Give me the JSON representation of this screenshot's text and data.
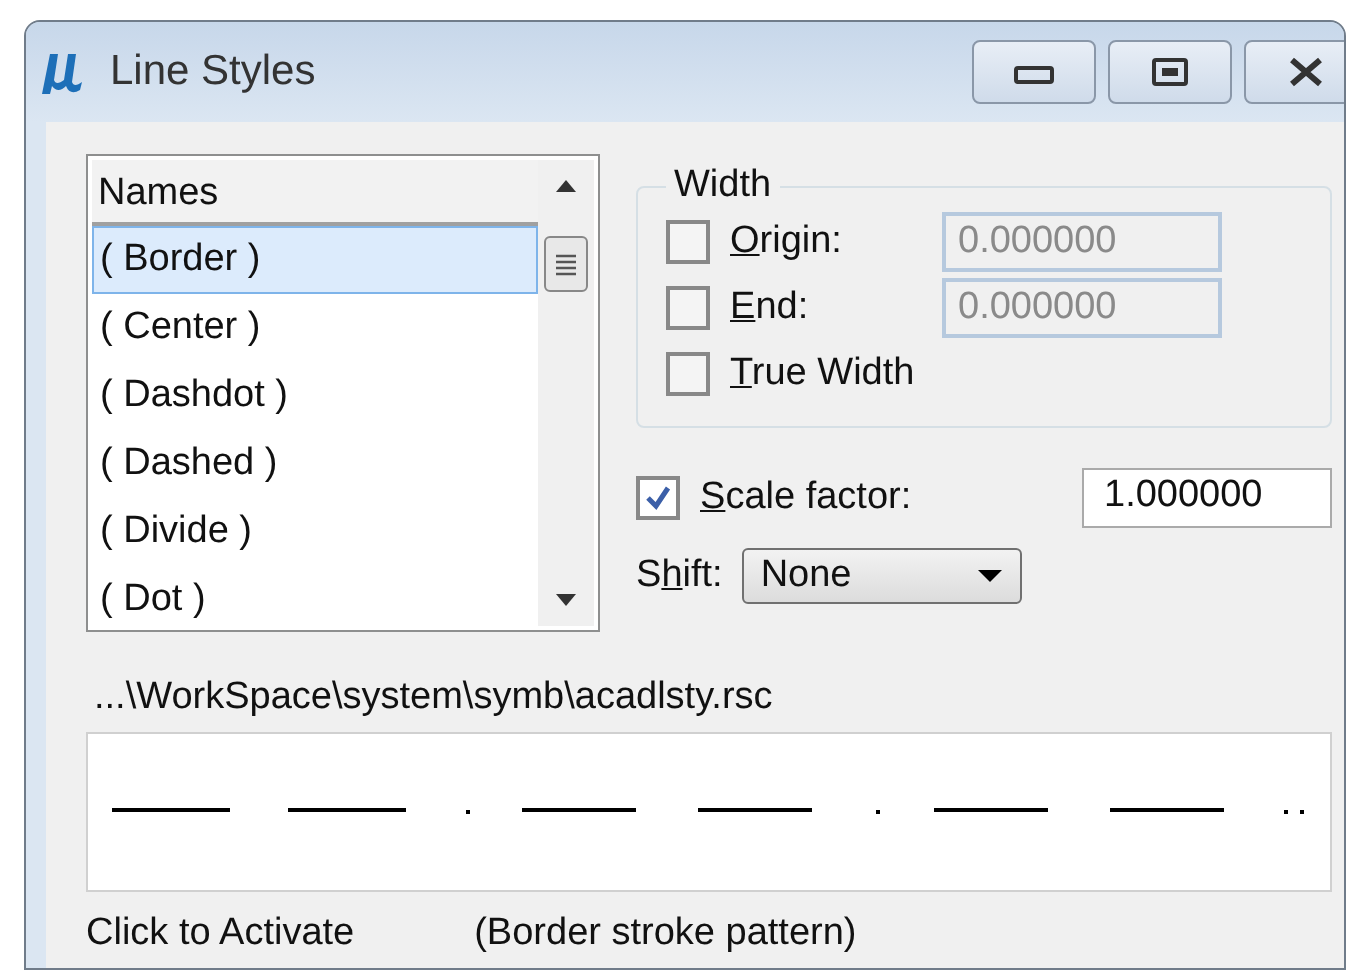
{
  "window": {
    "title": "Line Styles"
  },
  "names_list": {
    "header": "Names",
    "items": [
      {
        "label": "( Border )",
        "selected": true
      },
      {
        "label": "( Center )",
        "selected": false
      },
      {
        "label": "( Dashdot )",
        "selected": false
      },
      {
        "label": "( Dashed )",
        "selected": false
      },
      {
        "label": "( Divide )",
        "selected": false
      },
      {
        "label": "( Dot )",
        "selected": false
      }
    ]
  },
  "width_group": {
    "title": "Width",
    "rows": [
      {
        "kind": "field",
        "label": {
          "key": "O",
          "after": "rigin:"
        },
        "checked": false,
        "value": "0.000000",
        "disabled": true
      },
      {
        "kind": "field",
        "label": {
          "key": "E",
          "after": "nd:"
        },
        "checked": false,
        "value": "0.000000",
        "disabled": true
      },
      {
        "kind": "check",
        "label": {
          "key": "T",
          "after": "rue Width"
        },
        "checked": false
      }
    ]
  },
  "scale_factor": {
    "label": {
      "key": "S",
      "after": "cale factor:"
    },
    "checked": true,
    "value": "1.000000"
  },
  "shift": {
    "label": {
      "before": "S",
      "key": "h",
      "after": "ift:"
    },
    "value": "None"
  },
  "file_path": "...\\WorkSpace\\system\\symb\\acadlsty.rsc",
  "status_bar": {
    "hint": "Click to Activate",
    "description": "(Border stroke pattern)"
  }
}
